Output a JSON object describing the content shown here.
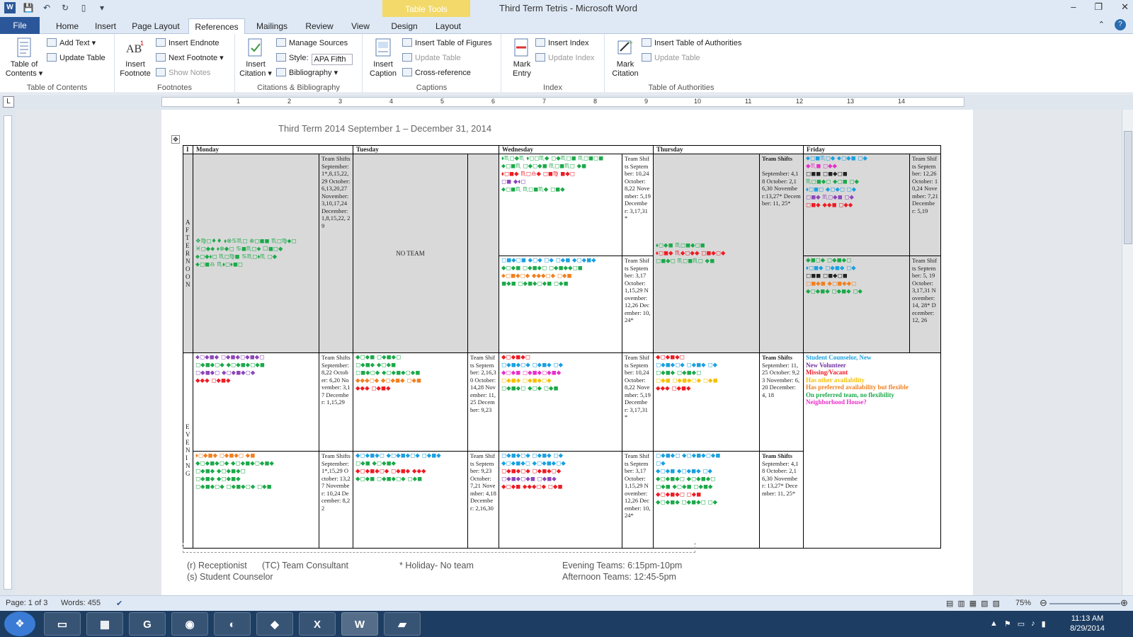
{
  "window": {
    "title": "Third Term Tetris - Microsoft Word",
    "table_tools": "Table Tools",
    "controls": [
      "–",
      "❐",
      "✕"
    ]
  },
  "tabs": [
    "File",
    "Home",
    "Insert",
    "Page Layout",
    "References",
    "Mailings",
    "Review",
    "View",
    "Design",
    "Layout"
  ],
  "ribbon": {
    "toc": {
      "big": "Table of Contents ▾",
      "add_text": "Add Text ▾",
      "update_table": "Update Table",
      "label": "Table of Contents"
    },
    "footnotes": {
      "big": "Insert Footnote",
      "endnote": "Insert Endnote",
      "next": "Next Footnote ▾",
      "show": "Show Notes",
      "label": "Footnotes"
    },
    "citations": {
      "big": "Insert Citation ▾",
      "manage": "Manage Sources",
      "style_label": "Style:",
      "style_value": "APA Fifth",
      "biblio": "Bibliography ▾",
      "label": "Citations & Bibliography"
    },
    "captions": {
      "big": "Insert Caption",
      "tof": "Insert Table of Figures",
      "update": "Update Table",
      "cross": "Cross-reference",
      "label": "Captions"
    },
    "index": {
      "big": "Mark Entry",
      "insert": "Insert Index",
      "update": "Update Index",
      "label": "Index"
    },
    "authorities": {
      "big": "Mark Citation",
      "insert": "Insert Table of Authorities",
      "update": "Update Table",
      "label": "Table of Authorities"
    }
  },
  "ruler_numbers": [
    "1",
    "2",
    "3",
    "4",
    "5",
    "6",
    "7",
    "8",
    "9",
    "10",
    "11",
    "12",
    "13",
    "14"
  ],
  "document": {
    "heading": "Third Term 2014 September 1 – December 31, 2014",
    "table": {
      "corner": "I",
      "days": [
        "Monday",
        "Tuesday",
        "Wednesday",
        "Thursday",
        "Friday"
      ],
      "afternoon_label": "A F T E R N O O N",
      "evening_label": "E V E N I N G",
      "no_team": "NO TEAM",
      "shifts": {
        "mon_aft": "Team Shifts September: 1*,8,15,22,29 October: 6,13,20,27 November: 3,10,17,24 December: 1,8,15,22, 29",
        "wed_aft1": "Team Shifts September: 10,24 October: 8,22 November: 5,19 December: 3,17,31*",
        "wed_aft2": "Team Shifts September: 3,17 October: 1,15,29 November: 12,26 December: 10,24*",
        "thu_aft": "September: 4,18 October: 2,16,30 November:13,27* December: 11, 25*",
        "thu_aft_title": "Team Shifts",
        "fri_aft1": "Team Shifts September: 12,26 October: 10,24 November: 7,21 December: 5,19",
        "fri_aft2": "Team Shifts September: 5, 19 October: 3,17,31 November: 14, 28* December: 12, 26",
        "mon_eve1": "Team Shifts September: 8,22 October: 6,20 November: 3,17 December: 1,15,29",
        "mon_eve2": "Team Shifts September: 1*,15,29 October: 13,27 November: 10,24 December: 8,22",
        "tue_eve1": "Team Shifts September: 2,16,30 October: 14,28 November: 11,25 December: 9,23",
        "tue_eve2": "Team Shifts September: 9,23 October: 7,21 November: 4,18 December: 2,16,30",
        "wed_eve1": "Team Shifts September: 10,24 October: 8,22 November: 5,19 December: 3,17,31*",
        "wed_eve2": "Team Shifts September: 3,17 October: 1,15,29 November: 12,26 December: 10,24*",
        "thu_eve1": "September: 11, 25 October: 9,23 November: 6,20 December: 4, 18",
        "thu_eve2": "September: 4,18 October: 2,16,30 November: 13,27* December: 11, 25*",
        "team_shifts": "Team Shifts"
      },
      "legend": [
        {
          "text": "Student Counselor, New",
          "color": "#1aa0e0"
        },
        {
          "text": "New Volunteer",
          "color": "#7030a0"
        },
        {
          "text": "Missing/Vacant",
          "color": "#ee1c24"
        },
        {
          "text": "Has other availability",
          "color": "#f6c000"
        },
        {
          "text": "Has preferred availability but flexible",
          "color": "#f08020"
        },
        {
          "text": "On preferred team, no flexibility",
          "color": "#1ca94a"
        },
        {
          "text": "Neighborhood House?",
          "color": "#e830c8"
        }
      ]
    },
    "footnotes": {
      "receptionist": "(r) Receptionist",
      "tc": "(TC) Team Consultant",
      "holiday": "* Holiday- No team",
      "evening": "Evening Teams: 6:15pm-10pm",
      "counselor": "(s) Student Counselor",
      "afternoon": "Afternoon Teams: 12:45-5pm"
    }
  },
  "status": {
    "page": "Page: 1 of 3",
    "words": "Words: 455",
    "zoom": "75%"
  },
  "taskbar": {
    "time": "11:13 AM",
    "date": "8/29/2014"
  }
}
